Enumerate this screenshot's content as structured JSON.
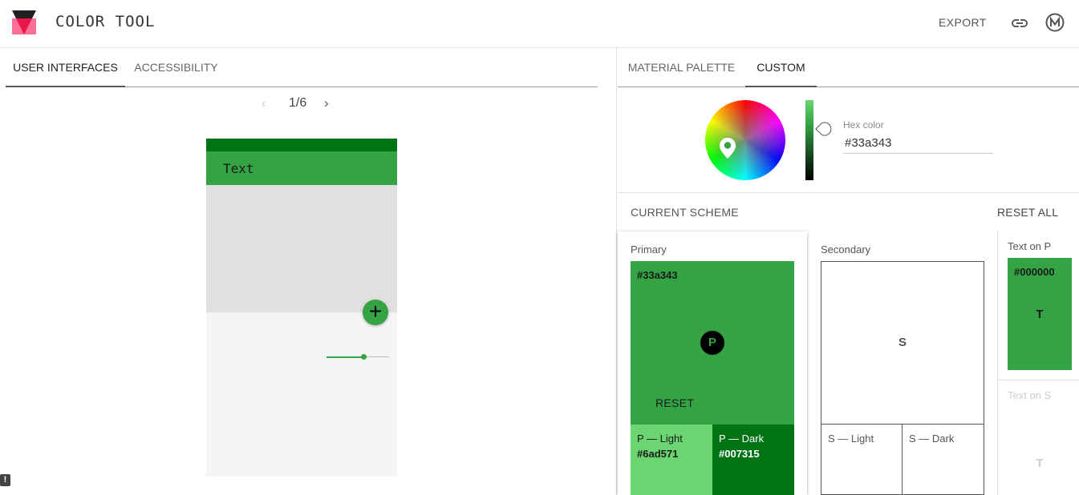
{
  "header": {
    "title": "COLOR TOOL",
    "export_label": "EXPORT"
  },
  "left": {
    "tabs": [
      {
        "label": "USER INTERFACES",
        "active": true
      },
      {
        "label": "ACCESSIBILITY",
        "active": false
      }
    ],
    "pager": {
      "text": "1/6",
      "prev": "‹",
      "next": "›"
    },
    "phone": {
      "appbar_text": "Text",
      "fab_symbol": "+",
      "slider_value": 0.6
    },
    "feedback_symbol": "!"
  },
  "right": {
    "tabs": [
      {
        "label": "MATERIAL PALETTE",
        "active": false
      },
      {
        "label": "CUSTOM",
        "active": true
      }
    ],
    "picker": {
      "hex_label": "Hex color",
      "hex_value": "#33a343"
    },
    "scheme": {
      "title": "CURRENT SCHEME",
      "reset_all": "RESET ALL",
      "primary": {
        "label": "Primary",
        "hex": "#33a343",
        "badge": "P",
        "reset": "RESET",
        "light": {
          "label": "P — Light",
          "hex": "#6ad571"
        },
        "dark": {
          "label": "P — Dark",
          "hex": "#007315"
        }
      },
      "secondary": {
        "label": "Secondary",
        "badge": "S",
        "light": {
          "label": "S — Light"
        },
        "dark": {
          "label": "S — Dark"
        }
      },
      "text_on_p": {
        "label": "Text on P",
        "hex": "#000000",
        "letter": "T"
      },
      "text_on_s": {
        "label": "Text on S",
        "letter": "T"
      }
    }
  },
  "colors": {
    "primary": "#33a343",
    "primary_light": "#6ad571",
    "primary_dark": "#007315",
    "logo_pink": "#ff4081",
    "logo_dark": "#212121"
  }
}
